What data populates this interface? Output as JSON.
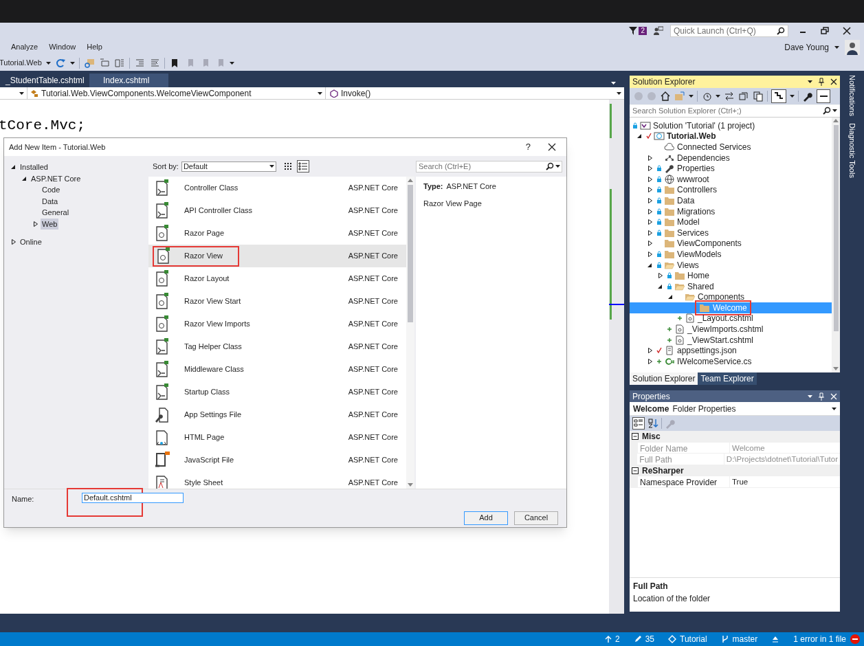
{
  "title_bar": {
    "notification_count": "2",
    "quick_launch": {
      "placeholder": "Quick Launch (Ctrl+Q)"
    }
  },
  "menu": [
    "Analyze",
    "Window",
    "Help"
  ],
  "account": {
    "name": "Dave Young"
  },
  "toolbar": {
    "project": "Tutorial.Web"
  },
  "editor": {
    "tabs": [
      {
        "label": "_StudentTable.cshtml",
        "highlighted": false
      },
      {
        "label": "Index.cshtml",
        "highlighted": true
      }
    ],
    "nav_type": "Tutorial.Web.ViewComponents.WelcomeViewComponent",
    "nav_member": "Invoke()",
    "code_lines": [
      "tCore.Mvc;"
    ]
  },
  "dialog": {
    "title": "Add New Item - Tutorial.Web",
    "help": "?",
    "tree": [
      {
        "label": "Installed",
        "expanded": true,
        "selected": false,
        "children": [
          {
            "label": "ASP.NET Core",
            "expanded": true,
            "selected": false,
            "children": [
              {
                "label": "Code",
                "selected": false
              },
              {
                "label": "Data",
                "selected": false
              },
              {
                "label": "General",
                "selected": false
              },
              {
                "label": "Web",
                "expanded": false,
                "selected": true
              }
            ]
          }
        ]
      },
      {
        "label": "Online",
        "expanded": false,
        "selected": false
      }
    ],
    "sort_label": "Sort by:",
    "sort_value": "Default",
    "view_modes": [
      {
        "kind": "grid",
        "selected": false
      },
      {
        "kind": "list",
        "selected": true
      }
    ],
    "search_placeholder": "Search (Ctrl+E)",
    "items": [
      {
        "name": "Controller Class",
        "category": "ASP.NET Core",
        "kind": "class",
        "selected": false,
        "annotated": false
      },
      {
        "name": "API Controller Class",
        "category": "ASP.NET Core",
        "kind": "class",
        "selected": false,
        "annotated": false
      },
      {
        "name": "Razor Page",
        "category": "ASP.NET Core",
        "kind": "razor",
        "selected": false,
        "annotated": false
      },
      {
        "name": "Razor View",
        "category": "ASP.NET Core",
        "kind": "razor",
        "selected": true,
        "annotated": true
      },
      {
        "name": "Razor Layout",
        "category": "ASP.NET Core",
        "kind": "razor",
        "selected": false,
        "annotated": false
      },
      {
        "name": "Razor View Start",
        "category": "ASP.NET Core",
        "kind": "razor",
        "selected": false,
        "annotated": false
      },
      {
        "name": "Razor View Imports",
        "category": "ASP.NET Core",
        "kind": "razor",
        "selected": false,
        "annotated": false
      },
      {
        "name": "Tag Helper Class",
        "category": "ASP.NET Core",
        "kind": "class",
        "selected": false,
        "annotated": false
      },
      {
        "name": "Middleware Class",
        "category": "ASP.NET Core",
        "kind": "class",
        "selected": false,
        "annotated": false
      },
      {
        "name": "Startup Class",
        "category": "ASP.NET Core",
        "kind": "class",
        "selected": false,
        "annotated": false
      },
      {
        "name": "App Settings File",
        "category": "ASP.NET Core",
        "kind": "settings",
        "selected": false,
        "annotated": false
      },
      {
        "name": "HTML Page",
        "category": "ASP.NET Core",
        "kind": "html",
        "selected": false,
        "annotated": false
      },
      {
        "name": "JavaScript File",
        "category": "ASP.NET Core",
        "kind": "js",
        "selected": false,
        "annotated": false
      },
      {
        "name": "Style Sheet",
        "category": "ASP.NET Core",
        "kind": "css",
        "selected": false,
        "annotated": false
      }
    ],
    "detail": {
      "type_label": "Type:",
      "type_value": "ASP.NET Core",
      "description": "Razor View Page"
    },
    "name_label": "Name:",
    "name_value": "Default.cshtml",
    "name_annotated": true,
    "buttons": [
      {
        "label": "Add",
        "default": true
      },
      {
        "label": "Cancel",
        "default": false
      }
    ]
  },
  "solution_explorer": {
    "title": "Solution Explorer",
    "search_placeholder": "Search Solution Explorer (Ctrl+;)",
    "tree": [
      {
        "label": "Solution 'Tutorial' (1 project)",
        "kind": "solution",
        "vcs": {
          "kind": "locked"
        },
        "selected": false,
        "children": [
          {
            "label": "Tutorial.Web",
            "kind": "project",
            "vcs": {
              "kind": "modified"
            },
            "expanded": true,
            "bold": true,
            "selected": false,
            "children": [
              {
                "label": "Connected Services",
                "kind": "service",
                "selected": false
              },
              {
                "label": "Dependencies",
                "kind": "dependencies",
                "expanded": false,
                "selected": false
              },
              {
                "label": "Properties",
                "kind": "properties",
                "vcs": {
                  "kind": "locked"
                },
                "expanded": false,
                "selected": false
              },
              {
                "label": "wwwroot",
                "kind": "web",
                "vcs": {
                  "kind": "locked"
                },
                "expanded": false,
                "selected": false
              },
              {
                "label": "Controllers",
                "kind": "folder",
                "vcs": {
                  "kind": "locked"
                },
                "expanded": false,
                "selected": false
              },
              {
                "label": "Data",
                "kind": "folder",
                "vcs": {
                  "kind": "locked"
                },
                "expanded": false,
                "selected": false
              },
              {
                "label": "Migrations",
                "kind": "folder",
                "vcs": {
                  "kind": "locked"
                },
                "expanded": false,
                "selected": false
              },
              {
                "label": "Model",
                "kind": "folder",
                "vcs": {
                  "kind": "locked"
                },
                "expanded": false,
                "selected": false
              },
              {
                "label": "Services",
                "kind": "folder",
                "vcs": {
                  "kind": "locked"
                },
                "expanded": false,
                "selected": false
              },
              {
                "label": "ViewComponents",
                "kind": "folder",
                "expanded": false,
                "selected": false
              },
              {
                "label": "ViewModels",
                "kind": "folder",
                "vcs": {
                  "kind": "locked"
                },
                "expanded": false,
                "selected": false
              },
              {
                "label": "Views",
                "kind": "folder",
                "vcs": {
                  "kind": "locked"
                },
                "expanded": true,
                "selected": false,
                "children": [
                  {
                    "label": "Home",
                    "kind": "folder",
                    "vcs": {
                      "kind": "locked"
                    },
                    "expanded": false,
                    "selected": false
                  },
                  {
                    "label": "Shared",
                    "kind": "folder",
                    "vcs": {
                      "kind": "locked"
                    },
                    "expanded": true,
                    "selected": false,
                    "children": [
                      {
                        "label": "Components",
                        "kind": "folder",
                        "expanded": true,
                        "selected": false,
                        "children": [
                          {
                            "label": "Welcome",
                            "kind": "folder",
                            "selected": true,
                            "annotated": true
                          }
                        ]
                      },
                      {
                        "label": "_Layout.cshtml",
                        "kind": "razor",
                        "vcs": {
                          "kind": "added"
                        },
                        "selected": false
                      }
                    ]
                  },
                  {
                    "label": "_ViewImports.cshtml",
                    "kind": "razor",
                    "vcs": {
                      "kind": "added"
                    },
                    "selected": false
                  },
                  {
                    "label": "_ViewStart.cshtml",
                    "kind": "razor",
                    "vcs": {
                      "kind": "added"
                    },
                    "selected": false
                  }
                ]
              },
              {
                "label": "appsettings.json",
                "kind": "json",
                "vcs": {
                  "kind": "modified"
                },
                "expanded": false,
                "selected": false
              },
              {
                "label": "IWelcomeService.cs",
                "kind": "csharp",
                "vcs": {
                  "kind": "added"
                },
                "expanded": false,
                "selected": false
              }
            ]
          }
        ]
      }
    ],
    "tabs": [
      {
        "label": "Solution Explorer",
        "selected": true
      },
      {
        "label": "Team Explorer",
        "selected": false
      }
    ]
  },
  "properties": {
    "title": "Properties",
    "object_name": "Welcome",
    "object_type": "Folder Properties",
    "categories": [
      {
        "name": "Misc",
        "expanded": true,
        "rows": [
          {
            "name": "Folder Name",
            "value": "Welcome",
            "readonly": true
          },
          {
            "name": "Full Path",
            "value": "D:\\Projects\\dotnet\\Tutorial\\Tutor",
            "readonly": true
          }
        ]
      },
      {
        "name": "ReSharper",
        "expanded": true,
        "rows": [
          {
            "name": "Namespace Provider",
            "value": "True",
            "readonly": false
          }
        ]
      }
    ],
    "description_title": "Full Path",
    "description": "Location of the folder"
  },
  "side_tabs": [
    "Notifications",
    "Diagnostic Tools"
  ],
  "status_bar": {
    "items": [
      {
        "kind": "push",
        "text": "2"
      },
      {
        "kind": "changes",
        "text": "35"
      },
      {
        "kind": "repo",
        "text": "Tutorial"
      },
      {
        "kind": "branch",
        "text": "master"
      },
      {
        "kind": "publish"
      },
      {
        "kind": "errors",
        "text": "1 error in 1 file"
      }
    ]
  }
}
